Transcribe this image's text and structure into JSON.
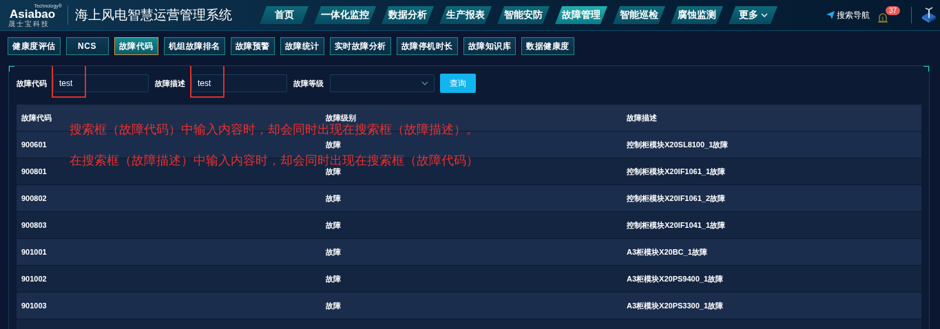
{
  "header": {
    "logo": {
      "tagline": "Technology®",
      "name": "Asiabao",
      "subtitle": "晟士宝科技"
    },
    "title": "海上风电智慧运营管理系统",
    "nav": [
      {
        "label": "首页",
        "selected": false
      },
      {
        "label": "一体化监控",
        "selected": false
      },
      {
        "label": "数据分析",
        "selected": false
      },
      {
        "label": "生产报表",
        "selected": false
      },
      {
        "label": "智能安防",
        "selected": false
      },
      {
        "label": "故障管理",
        "selected": true
      },
      {
        "label": "智能巡检",
        "selected": false
      },
      {
        "label": "腐蚀监测",
        "selected": false
      },
      {
        "label": "更多",
        "selected": false,
        "kind": "dropdown"
      }
    ],
    "search_nav": "搜索导航",
    "alarm_count": "37"
  },
  "subtabs": [
    {
      "label": "健康度评估",
      "selected": false
    },
    {
      "label": "NCS",
      "selected": false
    },
    {
      "label": "故障代码",
      "selected": true
    },
    {
      "label": "机组故障排名",
      "selected": false
    },
    {
      "label": "故障预警",
      "selected": false
    },
    {
      "label": "故障统计",
      "selected": false
    },
    {
      "label": "实时故障分析",
      "selected": false
    },
    {
      "label": "故障停机时长",
      "selected": false
    },
    {
      "label": "故障知识库",
      "selected": false
    },
    {
      "label": "数据健康度",
      "selected": false
    }
  ],
  "filters": [
    {
      "label": "故障代码",
      "kind": "text",
      "value": "test",
      "highlighted": true
    },
    {
      "label": "故障描述",
      "kind": "text",
      "value": "test",
      "highlighted": true
    },
    {
      "label": "故障等级",
      "kind": "select"
    }
  ],
  "query_button": "查询",
  "table": {
    "columns": [
      "故障代码",
      "故障级别",
      "故障描述"
    ],
    "rows": [
      [
        "900601",
        "故障",
        "控制柜模块X20SL8100_1故障"
      ],
      [
        "900801",
        "故障",
        "控制柜模块X20IF1061_1故障"
      ],
      [
        "900802",
        "故障",
        "控制柜模块X20IF1061_2故障"
      ],
      [
        "900803",
        "故障",
        "控制柜模块X20IF1041_1故障"
      ],
      [
        "901001",
        "故障",
        "A3柜模块X20BC_1故障"
      ],
      [
        "901002",
        "故障",
        "A3柜模块X20PS9400_1故障"
      ],
      [
        "901003",
        "故障",
        "A3柜模块X20PS3300_1故障"
      ]
    ]
  },
  "annotations": [
    "搜索框（故障代码）中输入内容时，却会同时出现在搜索框（故障描述）。",
    "在搜索框（故障描述）中输入内容时，却会同时出现在搜索框（故障代码）"
  ]
}
